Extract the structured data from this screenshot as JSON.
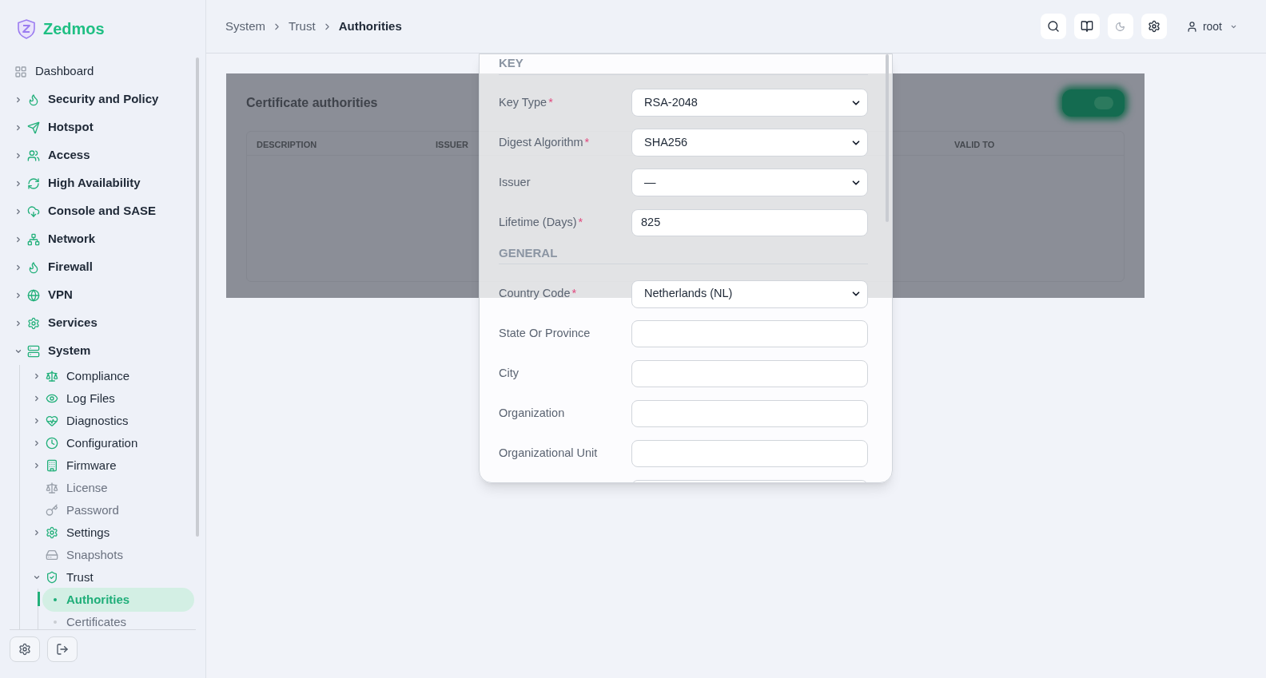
{
  "brand": "Zedmos",
  "sidebar": {
    "items": [
      {
        "label": "Dashboard",
        "kind": "link"
      },
      {
        "label": "Security and Policy",
        "kind": "group",
        "expanded": false
      },
      {
        "label": "Hotspot",
        "kind": "group",
        "expanded": false
      },
      {
        "label": "Access",
        "kind": "group",
        "expanded": false
      },
      {
        "label": "High Availability",
        "kind": "group",
        "expanded": false
      },
      {
        "label": "Console and SASE",
        "kind": "group",
        "expanded": false
      },
      {
        "label": "Network",
        "kind": "group",
        "expanded": false
      },
      {
        "label": "Firewall",
        "kind": "group",
        "expanded": false
      },
      {
        "label": "VPN",
        "kind": "group",
        "expanded": false
      },
      {
        "label": "Services",
        "kind": "group",
        "expanded": false
      },
      {
        "label": "System",
        "kind": "group",
        "expanded": true,
        "children": [
          {
            "label": "Compliance",
            "kind": "group",
            "expanded": false
          },
          {
            "label": "Log Files",
            "kind": "group",
            "expanded": false
          },
          {
            "label": "Diagnostics",
            "kind": "group",
            "expanded": false
          },
          {
            "label": "Configuration",
            "kind": "group",
            "expanded": false
          },
          {
            "label": "Firmware",
            "kind": "group",
            "expanded": false
          },
          {
            "label": "License",
            "kind": "link"
          },
          {
            "label": "Password",
            "kind": "link"
          },
          {
            "label": "Settings",
            "kind": "group",
            "expanded": false
          },
          {
            "label": "Snapshots",
            "kind": "link"
          },
          {
            "label": "Trust",
            "kind": "group",
            "expanded": true,
            "children": [
              {
                "label": "Authorities",
                "kind": "leaf",
                "selected": true
              },
              {
                "label": "Certificates",
                "kind": "leaf",
                "selected": false
              }
            ]
          }
        ]
      }
    ]
  },
  "breadcrumb": [
    {
      "label": "System",
      "current": false
    },
    {
      "label": "Trust",
      "current": false
    },
    {
      "label": "Authorities",
      "current": true
    }
  ],
  "user": {
    "name": "root"
  },
  "card": {
    "title": "Certificate authorities",
    "columns": [
      "DESCRIPTION",
      "ISSUER",
      "VALID TO"
    ]
  },
  "dialog": {
    "required_mark": "*",
    "sections": [
      {
        "title": "KEY",
        "fields": [
          {
            "label": "Key Type",
            "required": true,
            "kind": "select",
            "value": "RSA-2048"
          },
          {
            "label": "Digest Algorithm",
            "required": true,
            "kind": "select",
            "value": "SHA256"
          },
          {
            "label": "Issuer",
            "required": false,
            "kind": "select",
            "value": "—"
          },
          {
            "label": "Lifetime (Days)",
            "required": true,
            "kind": "input",
            "value": "825"
          }
        ]
      },
      {
        "title": "GENERAL",
        "fields": [
          {
            "label": "Country Code",
            "required": true,
            "kind": "select",
            "value": "Netherlands (NL)"
          },
          {
            "label": "State Or Province",
            "required": false,
            "kind": "input"
          },
          {
            "label": "City",
            "required": false,
            "kind": "input"
          },
          {
            "label": "Organization",
            "required": false,
            "kind": "input"
          },
          {
            "label": "Organizational Unit",
            "required": false,
            "kind": "input"
          },
          {
            "kind": "input"
          }
        ]
      }
    ]
  }
}
